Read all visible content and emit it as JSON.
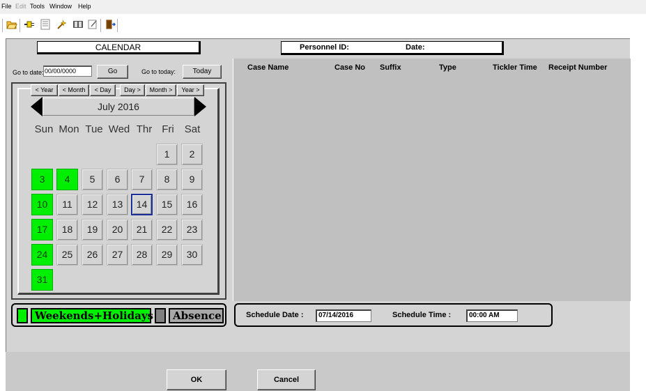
{
  "menu": [
    "File",
    "Edit",
    "Tools",
    "Window",
    "Help"
  ],
  "toolbar_icons": [
    "open-folder-icon",
    "plug-icon",
    "list-icon",
    "wizard-icon",
    "book-icon",
    "note-icon",
    "exit-door-icon"
  ],
  "calendar": {
    "title": "CALENDAR",
    "goto_date_label": "Go to date:",
    "goto_date_value": "00/00/0000",
    "go_label": "Go",
    "goto_today_label": "Go to today:",
    "today_label": "Today",
    "nav": [
      "< Year",
      "< Month",
      "< Day",
      "Day >",
      "Month >",
      "Year >"
    ],
    "month_label": "July 2016",
    "weekdays": [
      "Sun",
      "Mon",
      "Tue",
      "Wed",
      "Thr",
      "Fri",
      "Sat"
    ],
    "days": [
      "1",
      "2",
      "3",
      "4",
      "5",
      "6",
      "7",
      "8",
      "9",
      "10",
      "11",
      "12",
      "13",
      "14",
      "15",
      "16",
      "17",
      "18",
      "19",
      "20",
      "21",
      "22",
      "23",
      "24",
      "25",
      "26",
      "27",
      "28",
      "29",
      "30",
      "31"
    ],
    "highlighted_days": [
      "3",
      "4",
      "10",
      "17",
      "24",
      "31"
    ],
    "selected_day": "14",
    "highlight_color": "#00ee00",
    "selected_border_color": "#1a2f9a"
  },
  "legend": {
    "weekends_label": "Weekends+Holidays",
    "absence_label": "Absence",
    "weekends_color": "#00ee00",
    "absence_color": "#808080"
  },
  "header": {
    "personnel_label": "Personnel ID:",
    "date_label": "Date:"
  },
  "case_list": {
    "columns": [
      "Case Name",
      "Case No",
      "Suffix",
      "Type",
      "Tickler Time",
      "Receipt Number"
    ]
  },
  "schedule": {
    "date_label": "Schedule Date :",
    "date_value": "07/14/2016",
    "time_label": "Schedule Time :",
    "time_value": "00:00 AM"
  },
  "buttons": {
    "ok": "OK",
    "cancel": "Cancel"
  }
}
